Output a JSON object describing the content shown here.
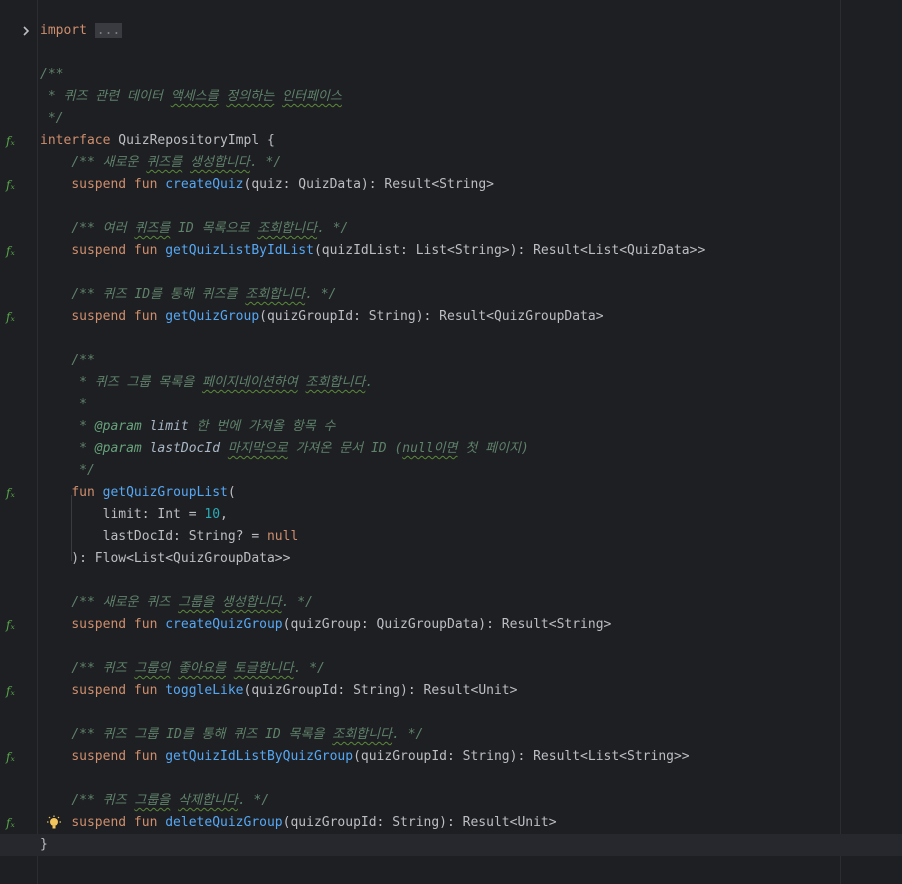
{
  "lines": [
    {
      "gutter": "fold",
      "parts": [
        [
          "kw",
          "import"
        ],
        [
          "plain",
          " "
        ],
        [
          "folded",
          "..."
        ]
      ]
    },
    {
      "parts": []
    },
    {
      "parts": [
        [
          "doc",
          "/**"
        ]
      ]
    },
    {
      "parts": [
        [
          "doc",
          " * "
        ],
        [
          "doc",
          "퀴즈 관련 데이터 "
        ],
        [
          "doctypo",
          "액세스를"
        ],
        [
          "doc",
          " "
        ],
        [
          "doctypo",
          "정의하는"
        ],
        [
          "doc",
          " "
        ],
        [
          "doctypo",
          "인터페이스"
        ]
      ]
    },
    {
      "parts": [
        [
          "doc",
          " */"
        ]
      ]
    },
    {
      "gutter": "fx",
      "parts": [
        [
          "kw",
          "interface"
        ],
        [
          "plain",
          " QuizRepositoryImpl {"
        ]
      ]
    },
    {
      "parts": [
        [
          "plain",
          "    "
        ],
        [
          "doc",
          "/** 새로운 "
        ],
        [
          "doctypo",
          "퀴즈를"
        ],
        [
          "doc",
          " "
        ],
        [
          "doctypo",
          "생성합니다"
        ],
        [
          "doc",
          ". */"
        ]
      ]
    },
    {
      "gutter": "fx",
      "parts": [
        [
          "plain",
          "    "
        ],
        [
          "kw",
          "suspend fun "
        ],
        [
          "fn",
          "createQuiz"
        ],
        [
          "plain",
          "(quiz: QuizData): Result<String>"
        ]
      ]
    },
    {
      "parts": []
    },
    {
      "parts": [
        [
          "plain",
          "    "
        ],
        [
          "doc",
          "/** 여러 "
        ],
        [
          "doctypo",
          "퀴즈를"
        ],
        [
          "doc",
          " ID 목록으로 "
        ],
        [
          "doctypo",
          "조회합니다"
        ],
        [
          "doc",
          ". */"
        ]
      ]
    },
    {
      "gutter": "fx",
      "parts": [
        [
          "plain",
          "    "
        ],
        [
          "kw",
          "suspend fun "
        ],
        [
          "fn",
          "getQuizListByIdList"
        ],
        [
          "plain",
          "(quizIdList: List<String>): Result<List<QuizData>>"
        ]
      ]
    },
    {
      "parts": []
    },
    {
      "parts": [
        [
          "plain",
          "    "
        ],
        [
          "doc",
          "/** 퀴즈 ID를 통해 퀴즈를 "
        ],
        [
          "doctypo",
          "조회합니다"
        ],
        [
          "doc",
          ". */"
        ]
      ]
    },
    {
      "gutter": "fx",
      "parts": [
        [
          "plain",
          "    "
        ],
        [
          "kw",
          "suspend fun "
        ],
        [
          "fn",
          "getQuizGroup"
        ],
        [
          "plain",
          "(quizGroupId: String): Result<QuizGroupData>"
        ]
      ]
    },
    {
      "parts": []
    },
    {
      "parts": [
        [
          "plain",
          "    "
        ],
        [
          "doc",
          "/**"
        ]
      ]
    },
    {
      "parts": [
        [
          "plain",
          "    "
        ],
        [
          "doc",
          " * 퀴즈 그룹 목록을 "
        ],
        [
          "doctypo",
          "페이지네이션하여"
        ],
        [
          "doc",
          " "
        ],
        [
          "doctypo",
          "조회합니다"
        ],
        [
          "doc",
          "."
        ]
      ]
    },
    {
      "parts": [
        [
          "plain",
          "    "
        ],
        [
          "doc",
          " *"
        ]
      ]
    },
    {
      "parts": [
        [
          "plain",
          "    "
        ],
        [
          "doc",
          " * "
        ],
        [
          "tag",
          "@param"
        ],
        [
          "doc",
          " "
        ],
        [
          "param",
          "limit"
        ],
        [
          "doc",
          " 한 번에 가져올 항목 수"
        ]
      ]
    },
    {
      "parts": [
        [
          "plain",
          "    "
        ],
        [
          "doc",
          " * "
        ],
        [
          "tag",
          "@param"
        ],
        [
          "doc",
          " "
        ],
        [
          "param",
          "lastDocId"
        ],
        [
          "doc",
          " "
        ],
        [
          "doctypo",
          "마지막으로"
        ],
        [
          "doc",
          " 가져온 문서 ID ("
        ],
        [
          "doctypo",
          "null이면"
        ],
        [
          "doc",
          " 첫 페이지)"
        ]
      ]
    },
    {
      "parts": [
        [
          "plain",
          "    "
        ],
        [
          "doc",
          " */"
        ]
      ]
    },
    {
      "gutter": "fx",
      "parts": [
        [
          "plain",
          "    "
        ],
        [
          "kw",
          "fun "
        ],
        [
          "fn",
          "getQuizGroupList"
        ],
        [
          "plain",
          "("
        ]
      ]
    },
    {
      "parts": [
        [
          "plain",
          "        limit: Int = "
        ],
        [
          "num",
          "10"
        ],
        [
          "plain",
          ","
        ]
      ]
    },
    {
      "parts": [
        [
          "plain",
          "        lastDocId: String? = "
        ],
        [
          "kw",
          "null"
        ]
      ]
    },
    {
      "parts": [
        [
          "plain",
          "    ): Flow<List<QuizGroupData>>"
        ]
      ]
    },
    {
      "parts": []
    },
    {
      "parts": [
        [
          "plain",
          "    "
        ],
        [
          "doc",
          "/** 새로운 퀴즈 "
        ],
        [
          "doctypo",
          "그룹을"
        ],
        [
          "doc",
          " "
        ],
        [
          "doctypo",
          "생성합니다"
        ],
        [
          "doc",
          ". */"
        ]
      ]
    },
    {
      "gutter": "fx",
      "parts": [
        [
          "plain",
          "    "
        ],
        [
          "kw",
          "suspend fun "
        ],
        [
          "fn",
          "createQuizGroup"
        ],
        [
          "plain",
          "(quizGroup: QuizGroupData): Result<String>"
        ]
      ]
    },
    {
      "parts": []
    },
    {
      "parts": [
        [
          "plain",
          "    "
        ],
        [
          "doc",
          "/** 퀴즈 "
        ],
        [
          "doctypo",
          "그룹의"
        ],
        [
          "doc",
          " "
        ],
        [
          "doctypo",
          "좋아요를"
        ],
        [
          "doc",
          " "
        ],
        [
          "doctypo",
          "토글합니다"
        ],
        [
          "doc",
          ". */"
        ]
      ]
    },
    {
      "gutter": "fx",
      "parts": [
        [
          "plain",
          "    "
        ],
        [
          "kw",
          "suspend fun "
        ],
        [
          "fn",
          "toggleLike"
        ],
        [
          "plain",
          "(quizGroupId: String): Result<Unit>"
        ]
      ]
    },
    {
      "parts": []
    },
    {
      "parts": [
        [
          "plain",
          "    "
        ],
        [
          "doc",
          "/** 퀴즈 그룹 ID를 통해 퀴즈 ID 목록을 "
        ],
        [
          "doctypo",
          "조회합니다"
        ],
        [
          "doc",
          ". */"
        ]
      ]
    },
    {
      "gutter": "fx",
      "parts": [
        [
          "plain",
          "    "
        ],
        [
          "kw",
          "suspend fun "
        ],
        [
          "fn",
          "getQuizIdListByQuizGroup"
        ],
        [
          "plain",
          "(quizGroupId: String): Result<List<String>>"
        ]
      ]
    },
    {
      "parts": []
    },
    {
      "parts": [
        [
          "plain",
          "    "
        ],
        [
          "doc",
          "/** 퀴즈 "
        ],
        [
          "doctypo",
          "그룹을"
        ],
        [
          "doc",
          " "
        ],
        [
          "doctypo",
          "삭제합니다"
        ],
        [
          "doc",
          ". */"
        ]
      ]
    },
    {
      "gutter": "fx",
      "bulb": true,
      "parts": [
        [
          "plain",
          "    "
        ],
        [
          "kw",
          "suspend fun "
        ],
        [
          "fn",
          "deleteQuizGroup"
        ],
        [
          "plain",
          "(quizGroupId: String): Result<Unit>"
        ]
      ]
    },
    {
      "current": true,
      "parts": [
        [
          "plain",
          "}"
        ]
      ]
    }
  ],
  "gutter_icons": {
    "fx": "implement-icon",
    "fold": "fold-expand-icon",
    "bulb": "lightbulb-icon"
  },
  "colors": {
    "keyword": "#cf8e6d",
    "function": "#56a8f5",
    "doc": "#5f826b",
    "number": "#2aacb8",
    "background": "#1e1f22"
  }
}
